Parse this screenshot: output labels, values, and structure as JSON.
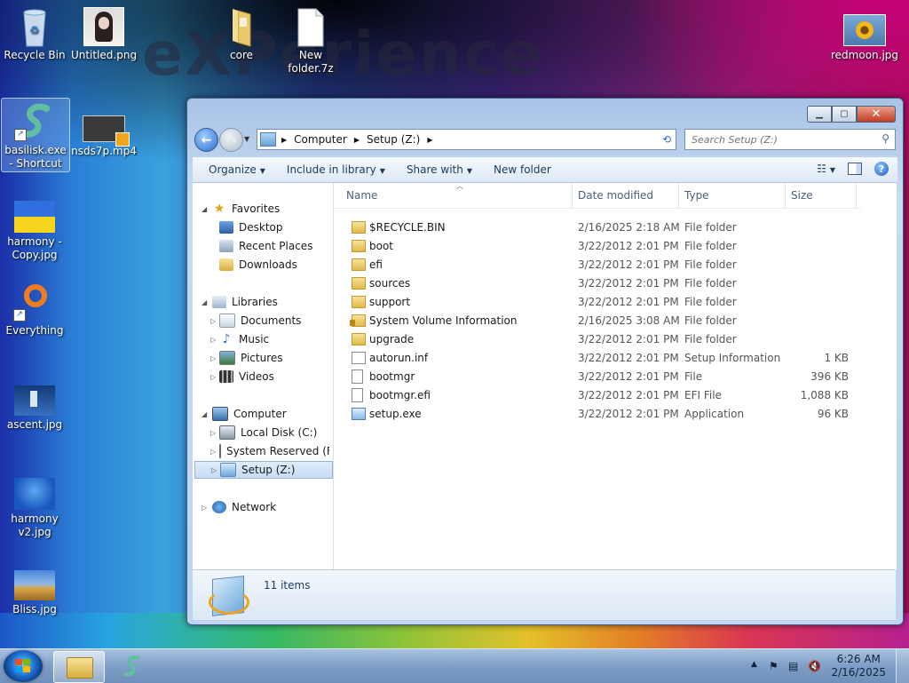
{
  "desktop": {
    "watermark": "eXPerience",
    "icons": [
      {
        "label": "Recycle Bin"
      },
      {
        "label": "Untitled.png"
      },
      {
        "label": "core"
      },
      {
        "label": "New folder.7z"
      },
      {
        "label": "redmoon.jpg"
      },
      {
        "label": "basilisk.exe - Shortcut"
      },
      {
        "label": "nsds7p.mp4"
      },
      {
        "label": "harmony - Copy.jpg"
      },
      {
        "label": "Everything"
      },
      {
        "label": "ascent.jpg"
      },
      {
        "label": "harmony v2.jpg"
      },
      {
        "label": "Bliss.jpg"
      }
    ]
  },
  "window": {
    "address": {
      "crumbs": [
        "Computer",
        "Setup (Z:)"
      ]
    },
    "search_placeholder": "Search Setup (Z:)",
    "toolbar": {
      "organize": "Organize",
      "include": "Include in library",
      "share": "Share with",
      "new_folder": "New folder"
    },
    "nav": {
      "favorites": "Favorites",
      "desktop": "Desktop",
      "recent": "Recent Places",
      "downloads": "Downloads",
      "libraries": "Libraries",
      "documents": "Documents",
      "music": "Music",
      "pictures": "Pictures",
      "videos": "Videos",
      "computer": "Computer",
      "local_disk": "Local Disk (C:)",
      "system_reserved": "System Reserved (F:)",
      "setup": "Setup (Z:)",
      "network": "Network"
    },
    "columns": {
      "name": "Name",
      "date": "Date modified",
      "type": "Type",
      "size": "Size"
    },
    "files": [
      {
        "name": "$RECYCLE.BIN",
        "date": "2/16/2025 2:18 AM",
        "type": "File folder",
        "size": "",
        "icon": "folder-icon"
      },
      {
        "name": "boot",
        "date": "3/22/2012 2:01 PM",
        "type": "File folder",
        "size": "",
        "icon": "folder-icon"
      },
      {
        "name": "efi",
        "date": "3/22/2012 2:01 PM",
        "type": "File folder",
        "size": "",
        "icon": "folder-icon"
      },
      {
        "name": "sources",
        "date": "3/22/2012 2:01 PM",
        "type": "File folder",
        "size": "",
        "icon": "folder-icon"
      },
      {
        "name": "support",
        "date": "3/22/2012 2:01 PM",
        "type": "File folder",
        "size": "",
        "icon": "folder-icon"
      },
      {
        "name": "System Volume Information",
        "date": "2/16/2025 3:08 AM",
        "type": "File folder",
        "size": "",
        "icon": "locked-folder-icon"
      },
      {
        "name": "upgrade",
        "date": "3/22/2012 2:01 PM",
        "type": "File folder",
        "size": "",
        "icon": "folder-icon"
      },
      {
        "name": "autorun.inf",
        "date": "3/22/2012 2:01 PM",
        "type": "Setup Information",
        "size": "1 KB",
        "icon": "settings-file-icon"
      },
      {
        "name": "bootmgr",
        "date": "3/22/2012 2:01 PM",
        "type": "File",
        "size": "396 KB",
        "icon": "file-icon"
      },
      {
        "name": "bootmgr.efi",
        "date": "3/22/2012 2:01 PM",
        "type": "EFI File",
        "size": "1,088 KB",
        "icon": "file-icon"
      },
      {
        "name": "setup.exe",
        "date": "3/22/2012 2:01 PM",
        "type": "Application",
        "size": "96 KB",
        "icon": "application-icon"
      }
    ],
    "status": "11 items"
  },
  "taskbar": {
    "time": "6:26 AM",
    "date": "2/16/2025"
  }
}
